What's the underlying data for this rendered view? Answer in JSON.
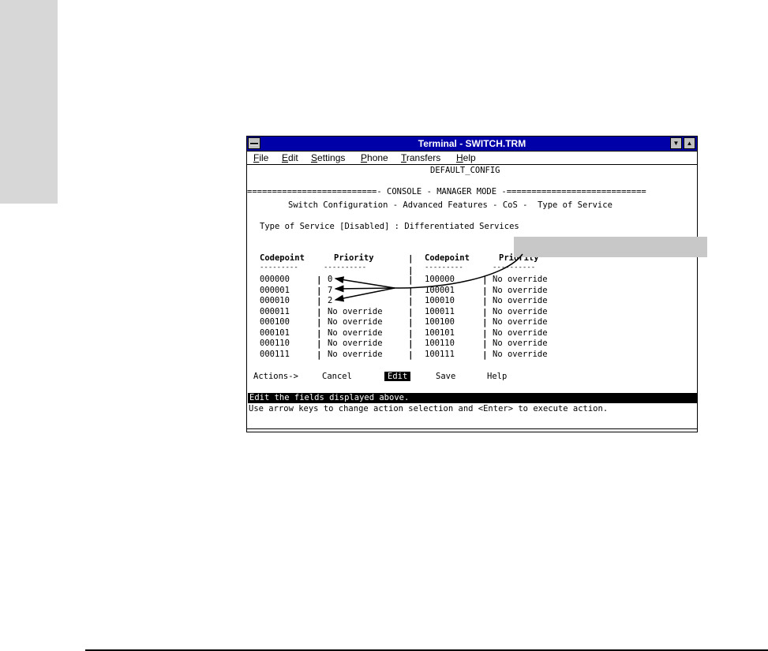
{
  "window": {
    "title": "Terminal - SWITCH.TRM",
    "system_menu_icon": "dash-icon",
    "min_icon": "down-arrow-icon",
    "max_icon": "up-arrow-icon"
  },
  "menubar": [
    {
      "first": "F",
      "rest": "ile"
    },
    {
      "first": "E",
      "rest": "dit"
    },
    {
      "first": "S",
      "rest": "ettings"
    },
    {
      "first": "P",
      "rest": "hone"
    },
    {
      "first": "T",
      "rest": "ransfers"
    },
    {
      "first": "H",
      "rest": "elp"
    }
  ],
  "console": {
    "config_name": "DEFAULT_CONFIG",
    "mode_banner": "==========================- CONSOLE - MANAGER MODE -============================",
    "screen_title": "Switch Configuration - Advanced Features - CoS -  Type of Service",
    "tos_line": "Type of Service [Disabled] : Differentiated Services",
    "headers": {
      "codepoint": "Codepoint",
      "priority": "Priority"
    },
    "dashes_codepoint": "---------",
    "dashes_priority": "----------",
    "table_left": [
      {
        "codepoint": "000000",
        "priority": "0"
      },
      {
        "codepoint": "000001",
        "priority": "7"
      },
      {
        "codepoint": "000010",
        "priority": "2"
      },
      {
        "codepoint": "000011",
        "priority": "No override"
      },
      {
        "codepoint": "000100",
        "priority": "No override"
      },
      {
        "codepoint": "000101",
        "priority": "No override"
      },
      {
        "codepoint": "000110",
        "priority": "No override"
      },
      {
        "codepoint": "000111",
        "priority": "No override"
      }
    ],
    "table_right": [
      {
        "codepoint": "100000",
        "priority": "No override"
      },
      {
        "codepoint": "100001",
        "priority": "No override"
      },
      {
        "codepoint": "100010",
        "priority": "No override"
      },
      {
        "codepoint": "100011",
        "priority": "No override"
      },
      {
        "codepoint": "100100",
        "priority": "No override"
      },
      {
        "codepoint": "100101",
        "priority": "No override"
      },
      {
        "codepoint": "100110",
        "priority": "No override"
      },
      {
        "codepoint": "100111",
        "priority": "No override"
      }
    ],
    "actions": {
      "label": "Actions->",
      "cancel": "Cancel",
      "edit": "Edit",
      "save": "Save",
      "help": "Help"
    },
    "status_line": "Edit the fields displayed above.",
    "hint_line": "Use arrow keys to change action selection and <Enter> to execute action."
  }
}
